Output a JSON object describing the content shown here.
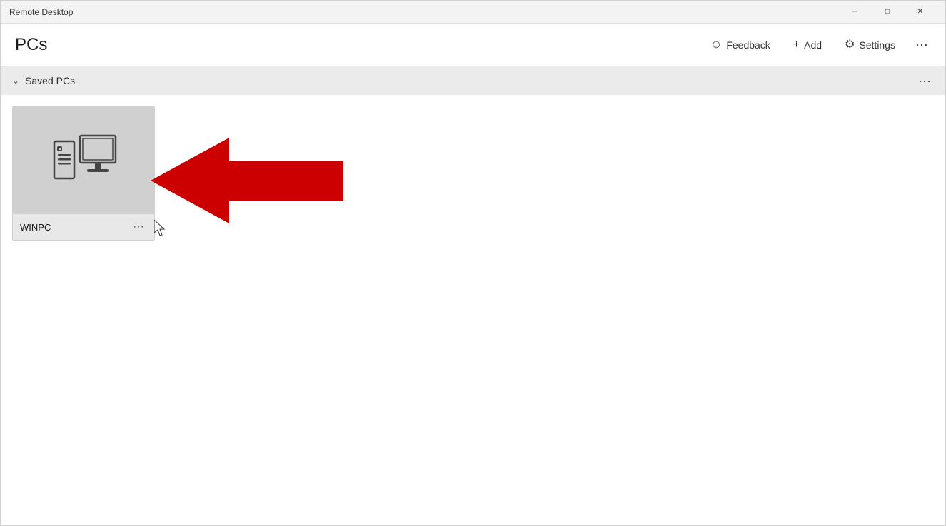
{
  "titleBar": {
    "title": "Remote Desktop",
    "minimizeLabel": "─",
    "maximizeLabel": "□",
    "closeLabel": "✕"
  },
  "header": {
    "pageTitle": "PCs",
    "feedbackLabel": "Feedback",
    "addLabel": "Add",
    "settingsLabel": "Settings",
    "moreLabel": "···"
  },
  "savedPCsSection": {
    "title": "Saved PCs",
    "moreLabel": "···"
  },
  "pcCards": [
    {
      "name": "WINPC",
      "moreLabel": "···"
    }
  ]
}
